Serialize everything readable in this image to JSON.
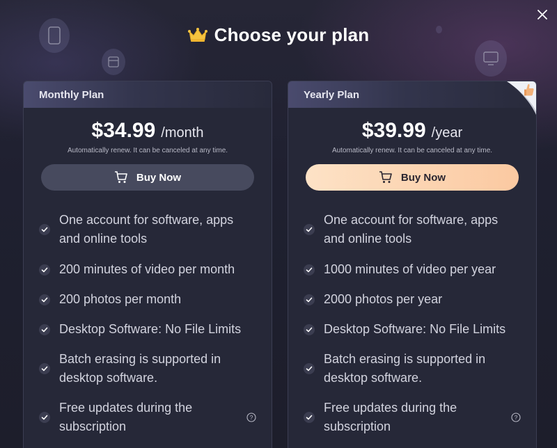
{
  "dialog": {
    "title": "Choose your plan"
  },
  "plans": [
    {
      "name": "Monthly Plan",
      "price": "$34.99",
      "period": "/month",
      "renew_note": "Automatically renew. It can be canceled at any time.",
      "buy_label": "Buy Now",
      "features": [
        "One account for software, apps and online tools",
        "200 minutes of video per month",
        "200 photos per month",
        "Desktop Software: No File Limits",
        "Batch erasing is supported in desktop software.",
        "Free updates during the subscription"
      ]
    },
    {
      "name": "Yearly Plan",
      "price": "$39.99",
      "period": "/year",
      "renew_note": "Automatically renew. It can be canceled at any time.",
      "buy_label": "Buy Now",
      "features": [
        "One account for software, apps and online tools",
        "1000 minutes of video per year",
        "2000 photos per year",
        "Desktop Software: No File Limits",
        "Batch erasing is supported in desktop software.",
        "Free updates during the subscription"
      ]
    }
  ],
  "colors": {
    "background": "#1d1e2b",
    "card": "#262838",
    "monthly_button": "#474a5e",
    "yearly_button": "#fbc9a1"
  },
  "icons": {
    "close": "close-icon",
    "crown": "crown-icon",
    "cart": "cart-icon",
    "check": "check-icon",
    "help": "help-icon",
    "thumbs_up": "thumbs-up-icon"
  }
}
